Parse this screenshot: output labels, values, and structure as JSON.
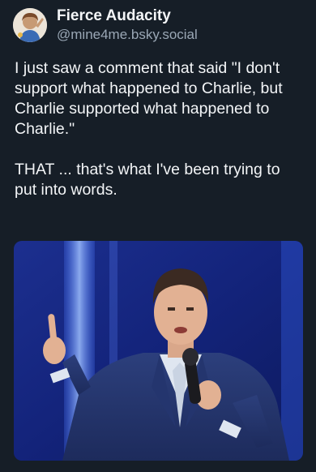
{
  "post": {
    "author": {
      "display_name": "Fierce Audacity",
      "handle": "@mine4me.bsky.social"
    },
    "paragraphs": [
      "I just saw a comment that said \"I don't support what happened to Charlie, but Charlie supported what happened to Charlie.\"",
      "THAT ... that's what I've been trying to put into words."
    ],
    "image": {
      "icon": "speaker-photo"
    }
  },
  "colors": {
    "background": "#161e27",
    "text": "#f3f5f7",
    "handle": "#9aa7b5",
    "stage_blue": "#1a2f8a"
  }
}
